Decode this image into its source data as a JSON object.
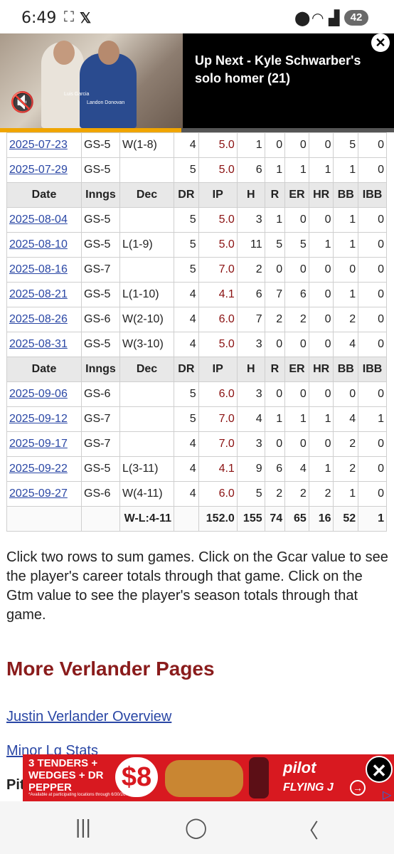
{
  "status_bar": {
    "time": "6:49",
    "battery": "42"
  },
  "video": {
    "up_next": "Up Next - Kyle Schwarber's solo homer (21)",
    "person1_name": "Luis Garcia",
    "person2_name": "Landon Donovan",
    "progress_fraction": 0.46
  },
  "table": {
    "headers": [
      "Date",
      "Inngs",
      "Dec",
      "DR",
      "IP",
      "H",
      "R",
      "ER",
      "HR",
      "BB",
      "IBB"
    ],
    "groups": [
      [
        [
          "2025-07-23",
          "GS-5",
          "W(1-8)",
          "4",
          "5.0",
          "1",
          "0",
          "0",
          "0",
          "5",
          "0"
        ],
        [
          "2025-07-29",
          "GS-5",
          "",
          "5",
          "5.0",
          "6",
          "1",
          "1",
          "1",
          "1",
          "0"
        ]
      ],
      [
        [
          "2025-08-04",
          "GS-5",
          "",
          "5",
          "5.0",
          "3",
          "1",
          "0",
          "0",
          "1",
          "0"
        ],
        [
          "2025-08-10",
          "GS-5",
          "L(1-9)",
          "5",
          "5.0",
          "11",
          "5",
          "5",
          "1",
          "1",
          "0"
        ],
        [
          "2025-08-16",
          "GS-7",
          "",
          "5",
          "7.0",
          "2",
          "0",
          "0",
          "0",
          "0",
          "0"
        ],
        [
          "2025-08-21",
          "GS-5",
          "L(1-10)",
          "4",
          "4.1",
          "6",
          "7",
          "6",
          "0",
          "1",
          "0"
        ],
        [
          "2025-08-26",
          "GS-6",
          "W(2-10)",
          "4",
          "6.0",
          "7",
          "2",
          "2",
          "0",
          "2",
          "0"
        ],
        [
          "2025-08-31",
          "GS-5",
          "W(3-10)",
          "4",
          "5.0",
          "3",
          "0",
          "0",
          "0",
          "4",
          "0"
        ]
      ],
      [
        [
          "2025-09-06",
          "GS-6",
          "",
          "5",
          "6.0",
          "3",
          "0",
          "0",
          "0",
          "0",
          "0"
        ],
        [
          "2025-09-12",
          "GS-7",
          "",
          "5",
          "7.0",
          "4",
          "1",
          "1",
          "1",
          "4",
          "1"
        ],
        [
          "2025-09-17",
          "GS-7",
          "",
          "4",
          "7.0",
          "3",
          "0",
          "0",
          "0",
          "2",
          "0"
        ],
        [
          "2025-09-22",
          "GS-5",
          "L(3-11)",
          "4",
          "4.1",
          "9",
          "6",
          "4",
          "1",
          "2",
          "0"
        ],
        [
          "2025-09-27",
          "GS-6",
          "W(4-11)",
          "4",
          "6.0",
          "5",
          "2",
          "2",
          "2",
          "1",
          "0"
        ]
      ]
    ],
    "totals": [
      "",
      "",
      "W-L:4-11",
      "",
      "152.0",
      "155",
      "74",
      "65",
      "16",
      "52",
      "1"
    ]
  },
  "help_text": "Click two rows to sum games. Click on the Gcar value to see the player's career totals through that game. Click on the Gtm value to see the player's season totals through that game.",
  "more_section": {
    "title": "More Verlander Pages",
    "links": [
      "Justin Verlander Overview",
      "Minor Lg Stats"
    ],
    "next_heading": "Pit"
  },
  "ad": {
    "headline": "3 TENDERS + WEDGES + DR PEPPER",
    "price": "$8",
    "fine_print": "*Available at participating locations through 6/30/26.",
    "brand": "pilot",
    "brand2": "FLYING J"
  }
}
